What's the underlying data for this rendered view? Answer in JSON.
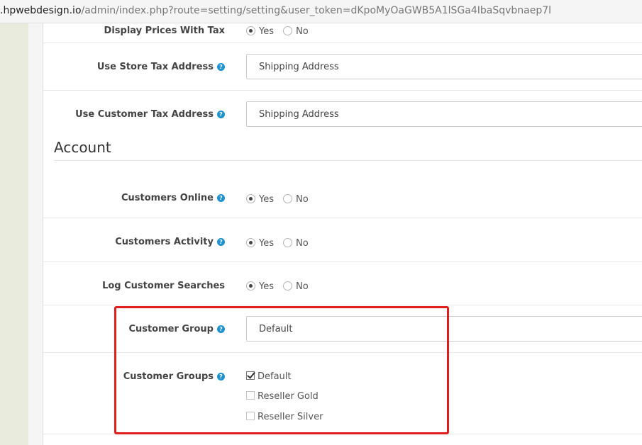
{
  "browser": {
    "url_host": ".hpwebdesign.io",
    "url_path": "/admin/index.php?route=setting/setting&user_token=dKpoMyOaGWB5A1lSGa4IbaSqvbnaep7l"
  },
  "help_glyph": "?",
  "top_row": {
    "label": "Display Prices With Tax",
    "yes": "Yes",
    "no": "No"
  },
  "store_tax": {
    "label": "Use Store Tax Address",
    "value": "Shipping Address"
  },
  "customer_tax": {
    "label": "Use Customer Tax Address",
    "value": "Shipping Address"
  },
  "account": {
    "title": "Account",
    "customers_online": {
      "label": "Customers Online",
      "yes": "Yes",
      "no": "No"
    },
    "customers_activity": {
      "label": "Customers Activity",
      "yes": "Yes",
      "no": "No"
    },
    "log_searches": {
      "label": "Log Customer Searches",
      "yes": "Yes",
      "no": "No"
    },
    "customer_group": {
      "label": "Customer Group",
      "value": "Default"
    },
    "customer_groups": {
      "label": "Customer Groups",
      "items": [
        {
          "label": "Default",
          "checked": true
        },
        {
          "label": "Reseller Gold",
          "checked": false
        },
        {
          "label": "Reseller Silver",
          "checked": false
        }
      ]
    }
  },
  "colors": {
    "help_icon": "#1e91cf",
    "highlight_border": "#e01e1e",
    "rail": "#e9ecdd"
  }
}
